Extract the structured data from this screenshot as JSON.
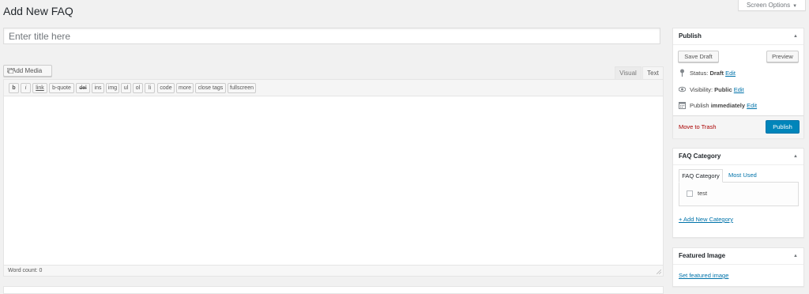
{
  "screen_options": {
    "label": "Screen Options"
  },
  "page": {
    "title": "Add New FAQ"
  },
  "title_field": {
    "placeholder": "Enter title here",
    "value": ""
  },
  "editor": {
    "add_media_label": "Add Media",
    "tabs": {
      "visual": "Visual",
      "text": "Text"
    },
    "quicktags": [
      "b",
      "i",
      "link",
      "b-quote",
      "del",
      "ins",
      "img",
      "ul",
      "ol",
      "li",
      "code",
      "more",
      "close tags",
      "fullscreen"
    ],
    "word_count": "Word count: 0"
  },
  "publish_box": {
    "title": "Publish",
    "save_draft_label": "Save Draft",
    "preview_label": "Preview",
    "status_label": "Status:",
    "status_value": "Draft",
    "visibility_label": "Visibility:",
    "visibility_value": "Public",
    "schedule_label": "Publish",
    "schedule_value": "immediately",
    "edit_link": "Edit",
    "move_to_trash": "Move to Trash",
    "publish_label": "Publish"
  },
  "category_box": {
    "title": "FAQ Category",
    "tabs": [
      "FAQ Category",
      "Most Used"
    ],
    "items": [
      {
        "label": "test",
        "checked": false
      }
    ],
    "add_new_label": "+ Add New Category"
  },
  "featured_image_box": {
    "title": "Featured Image",
    "set_link": "Set featured image"
  },
  "colors": {
    "primary": "#0085ba",
    "link": "#0073aa",
    "danger": "#a00000",
    "background": "#f1f1f1"
  }
}
